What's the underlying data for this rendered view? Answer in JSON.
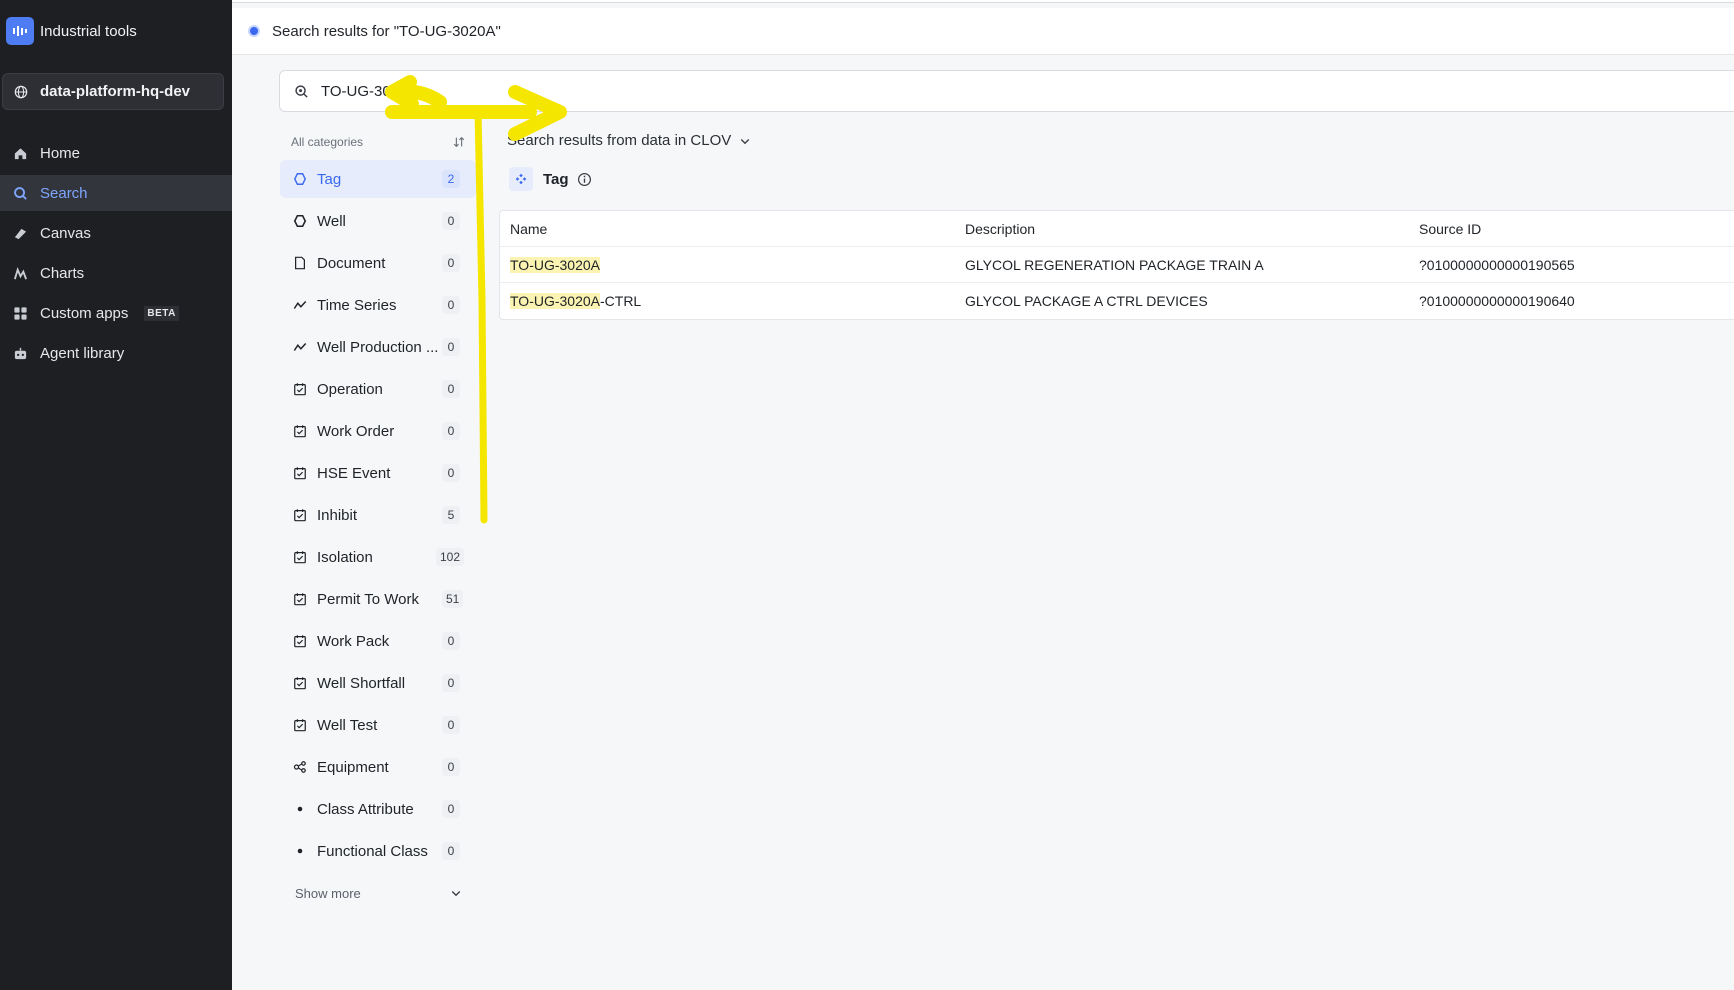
{
  "app": {
    "name": "Industrial tools"
  },
  "project": {
    "name": "data-platform-hq-dev"
  },
  "nav": {
    "home": "Home",
    "search": "Search",
    "canvas": "Canvas",
    "charts": "Charts",
    "custom_apps": "Custom apps",
    "beta": "BETA",
    "agent_library": "Agent library"
  },
  "topbar": {
    "title": "Search results for \"TO-UG-3020A\""
  },
  "search": {
    "value": "TO-UG-3020A"
  },
  "categories": {
    "header": "All categories",
    "items": [
      {
        "label": "Tag",
        "count": "2"
      },
      {
        "label": "Well",
        "count": "0"
      },
      {
        "label": "Document",
        "count": "0"
      },
      {
        "label": "Time Series",
        "count": "0"
      },
      {
        "label": "Well Production ...",
        "count": "0"
      },
      {
        "label": "Operation",
        "count": "0"
      },
      {
        "label": "Work Order",
        "count": "0"
      },
      {
        "label": "HSE Event",
        "count": "0"
      },
      {
        "label": "Inhibit",
        "count": "5"
      },
      {
        "label": "Isolation",
        "count": "102"
      },
      {
        "label": "Permit To Work",
        "count": "51"
      },
      {
        "label": "Work Pack",
        "count": "0"
      },
      {
        "label": "Well Shortfall",
        "count": "0"
      },
      {
        "label": "Well Test",
        "count": "0"
      },
      {
        "label": "Equipment",
        "count": "0"
      },
      {
        "label": "Class Attribute",
        "count": "0"
      },
      {
        "label": "Functional Class",
        "count": "0"
      }
    ],
    "show_more": "Show more"
  },
  "results": {
    "source_label": "Search results from data in CLOV",
    "section_title": "Tag",
    "columns": [
      "Name",
      "Description",
      "Source ID"
    ],
    "rows": [
      {
        "name_match": "TO-UG-3020A",
        "name_rest": "",
        "description": "GLYCOL REGENERATION PACKAGE TRAIN A",
        "source_id": "?0100000000000190565"
      },
      {
        "name_match": "TO-UG-3020A",
        "name_rest": "-CTRL",
        "description": "GLYCOL PACKAGE A CTRL DEVICES",
        "source_id": "?0100000000000190640"
      }
    ]
  },
  "colors": {
    "accent": "#3a68ef",
    "sidebar": "#1d1f23",
    "highlight": "#fbf3b1",
    "annotation": "#f5e600"
  }
}
